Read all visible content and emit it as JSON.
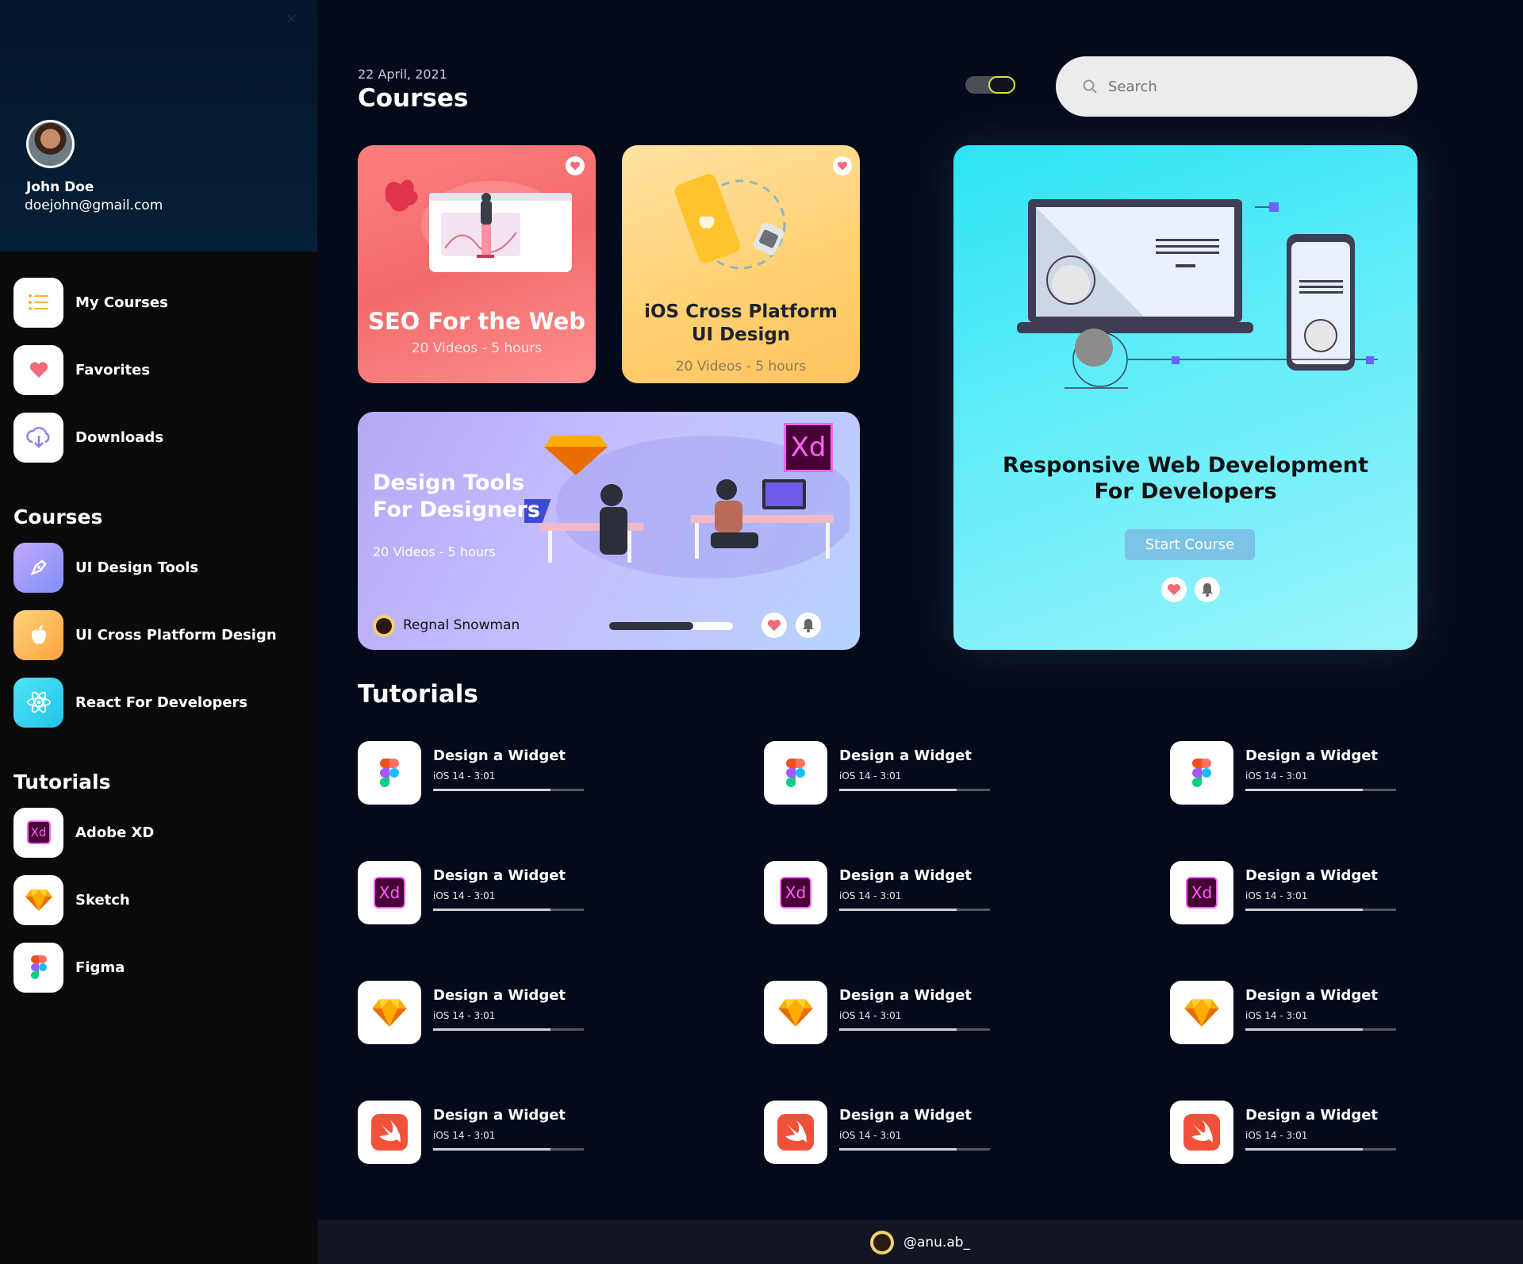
{
  "user": {
    "name": "John Doe",
    "email": "doejohn@gmail.com"
  },
  "nav": [
    {
      "label": "My Courses",
      "icon": "list-icon"
    },
    {
      "label": "Favorites",
      "icon": "heart-icon"
    },
    {
      "label": "Downloads",
      "icon": "cloud-download-icon"
    }
  ],
  "courses_section": {
    "title": "Courses",
    "items": [
      {
        "label": "UI Design Tools",
        "icon": "pen-icon"
      },
      {
        "label": "UI Cross Platform Design",
        "icon": "apple-icon"
      },
      {
        "label": "React For Developers",
        "icon": "react-icon"
      }
    ]
  },
  "tutorials_section": {
    "title": "Tutorials",
    "items": [
      {
        "label": "Adobe XD",
        "icon": "adobe-xd-icon"
      },
      {
        "label": "Sketch",
        "icon": "sketch-icon"
      },
      {
        "label": "Figma",
        "icon": "figma-icon"
      }
    ]
  },
  "header": {
    "date": "22 April, 2021",
    "title": "Courses",
    "search_placeholder": "Search"
  },
  "cards": {
    "seo": {
      "title": "SEO For the Web",
      "subtitle": "20 Videos - 5 hours"
    },
    "ios": {
      "title_line1": "iOS Cross Platform",
      "title_line2": "UI Design",
      "subtitle": "20 Videos - 5 hours"
    },
    "design": {
      "title_line1": "Design Tools",
      "title_line2": "For Designers",
      "subtitle": "20 Videos - 5 hours",
      "author": "Regnal Snowman",
      "progress": 0.68,
      "xd_label": "Xd"
    },
    "responsive": {
      "title_line1": "Responsive Web Development",
      "title_line2": "For Developers",
      "button": "Start Course"
    }
  },
  "tutorials": {
    "title": "Tutorials",
    "rows": [
      {
        "icon": "figma-icon",
        "items": [
          {
            "name": "Design a Widget",
            "meta": "iOS 14 - 3:01",
            "progress": 0.78
          },
          {
            "name": "Design a Widget",
            "meta": "iOS 14 - 3:01",
            "progress": 0.78
          },
          {
            "name": "Design a Widget",
            "meta": "iOS 14 - 3:01",
            "progress": 0.78
          }
        ]
      },
      {
        "icon": "adobe-xd-icon",
        "items": [
          {
            "name": "Design a Widget",
            "meta": "iOS 14 - 3:01",
            "progress": 0.78
          },
          {
            "name": "Design a Widget",
            "meta": "iOS 14 - 3:01",
            "progress": 0.78
          },
          {
            "name": "Design a Widget",
            "meta": "iOS 14 - 3:01",
            "progress": 0.78
          }
        ]
      },
      {
        "icon": "sketch-icon",
        "items": [
          {
            "name": "Design a Widget",
            "meta": "iOS 14 - 3:01",
            "progress": 0.78
          },
          {
            "name": "Design a Widget",
            "meta": "iOS 14 - 3:01",
            "progress": 0.78
          },
          {
            "name": "Design a Widget",
            "meta": "iOS 14 - 3:01",
            "progress": 0.78
          }
        ]
      },
      {
        "icon": "swift-icon",
        "items": [
          {
            "name": "Design a Widget",
            "meta": "iOS 14 - 3:01",
            "progress": 0.78
          },
          {
            "name": "Design a Widget",
            "meta": "iOS 14 - 3:01",
            "progress": 0.78
          },
          {
            "name": "Design a Widget",
            "meta": "iOS 14 - 3:01",
            "progress": 0.78
          }
        ]
      }
    ]
  },
  "footer": {
    "handle": "@anu.ab_"
  },
  "xd_text": "Xd",
  "colors": {
    "accent_red": "#ff6b6b",
    "accent_yellow": "#ffcf6f",
    "accent_cyan": "#2be3f5",
    "background": "#050a1a"
  }
}
